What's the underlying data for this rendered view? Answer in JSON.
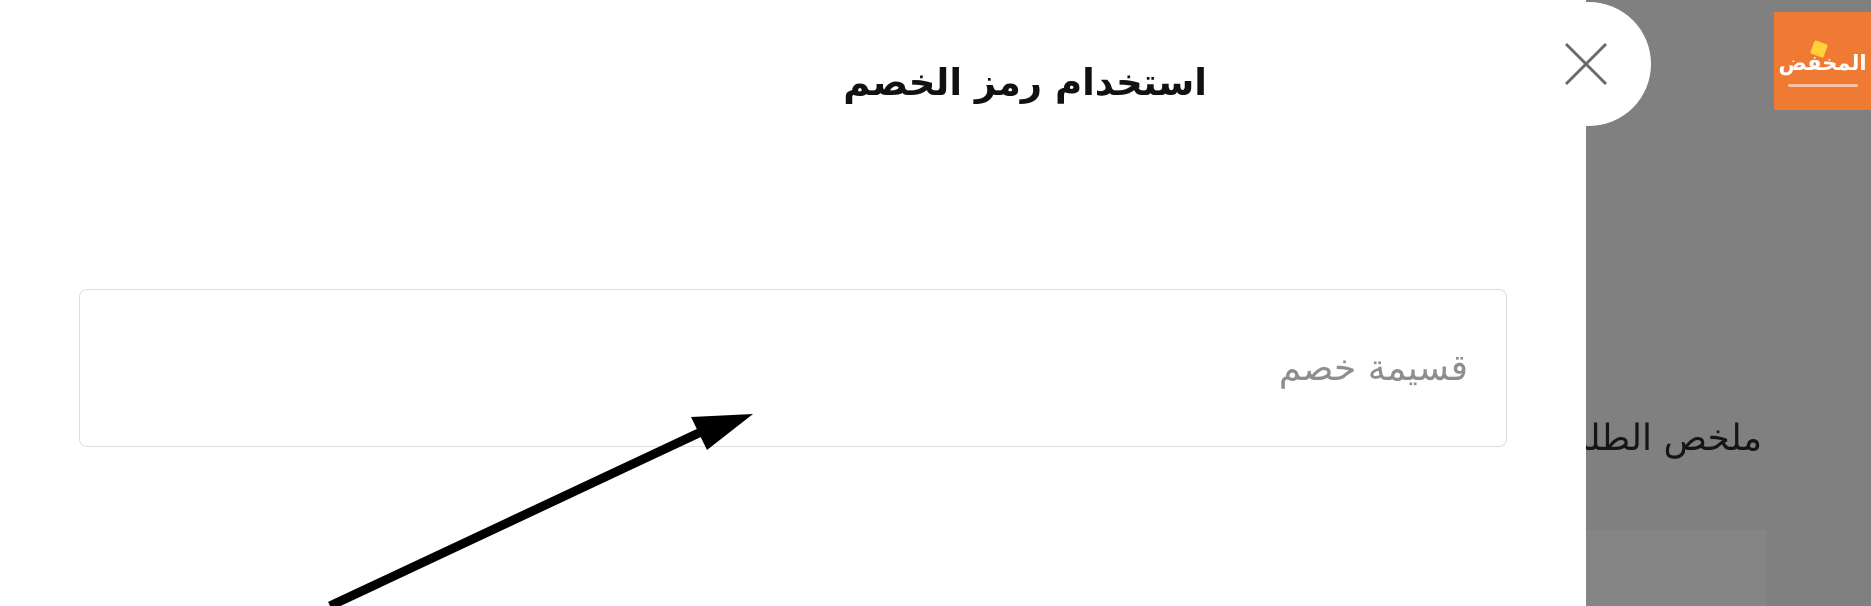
{
  "background": {
    "logo": {
      "text": "المخفض"
    },
    "summary_heading": "ملخص الطلب"
  },
  "drawer": {
    "title": "استخدام رمز الخصم",
    "close_icon": "close-icon",
    "discount_input": {
      "value": "",
      "placeholder": "قسيمة خصم"
    }
  },
  "colors": {
    "overlay": "#7f7f7f",
    "logo_bg": "#ef7a34",
    "logo_badge": "#ffd23a",
    "input_border": "#dddddd",
    "placeholder": "#8e8e8e"
  }
}
